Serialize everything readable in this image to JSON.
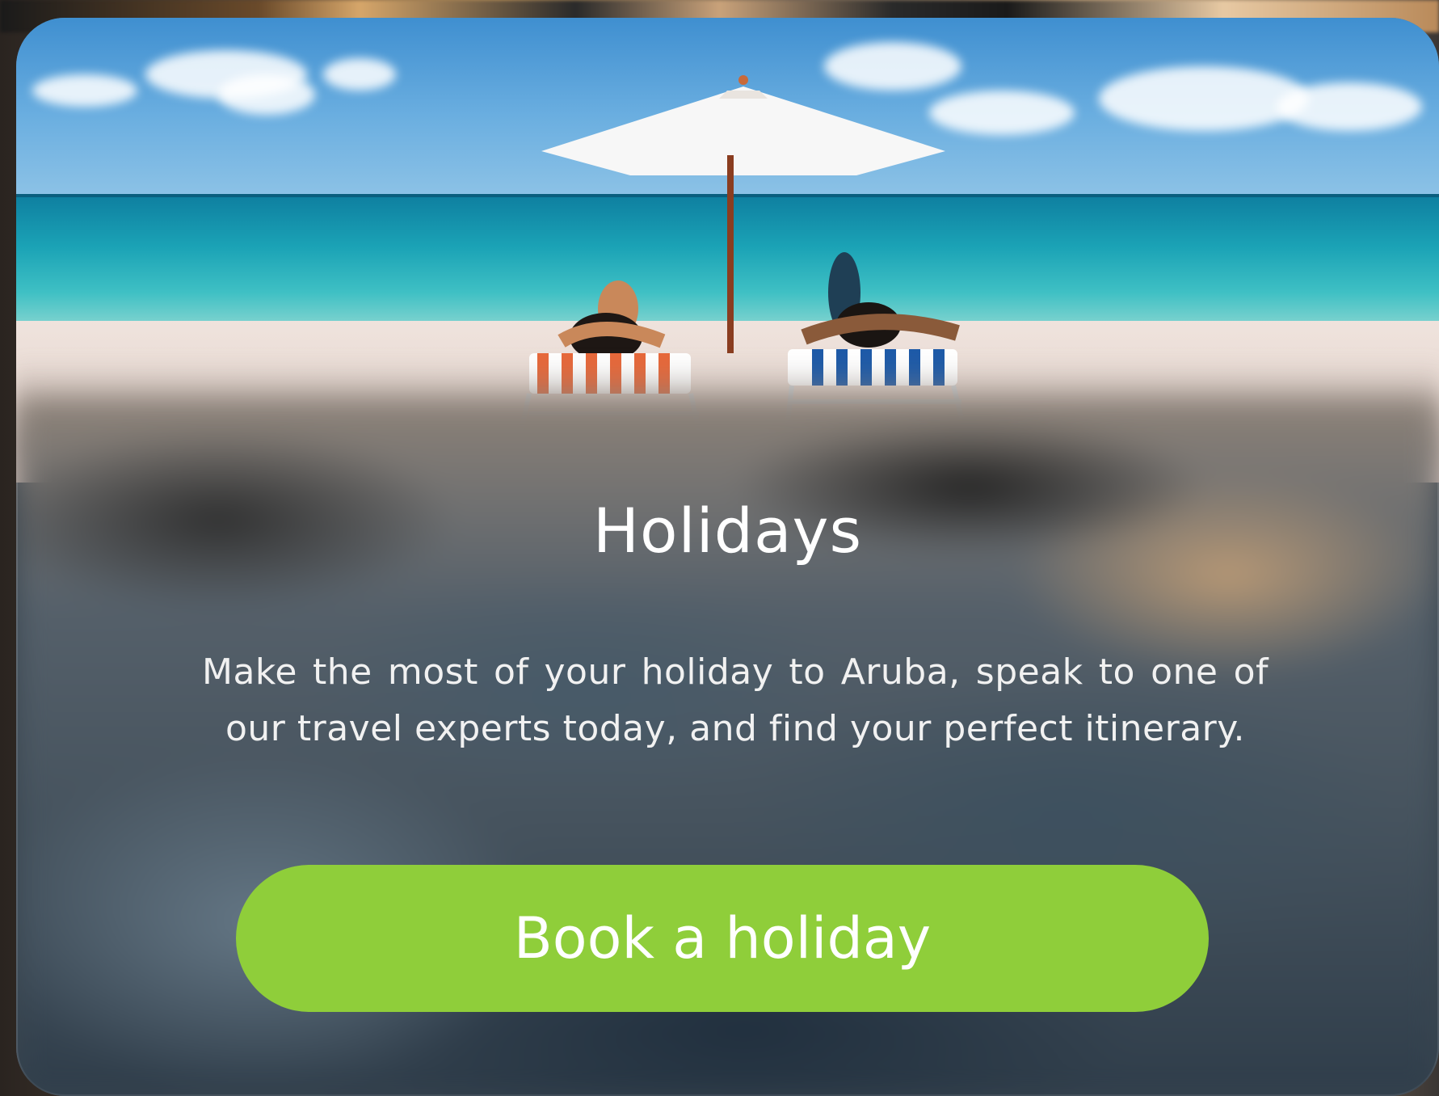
{
  "card": {
    "title": "Holidays",
    "description": "Make the most of your holiday to Aruba, speak to one of our travel experts today, and find your perfect itinerary.",
    "button_label": "Book a holiday"
  },
  "colors": {
    "button_bg": "#8fce3a",
    "button_text": "#ffffff",
    "title_text": "#ffffff"
  },
  "image": {
    "name": "beach-photo"
  }
}
